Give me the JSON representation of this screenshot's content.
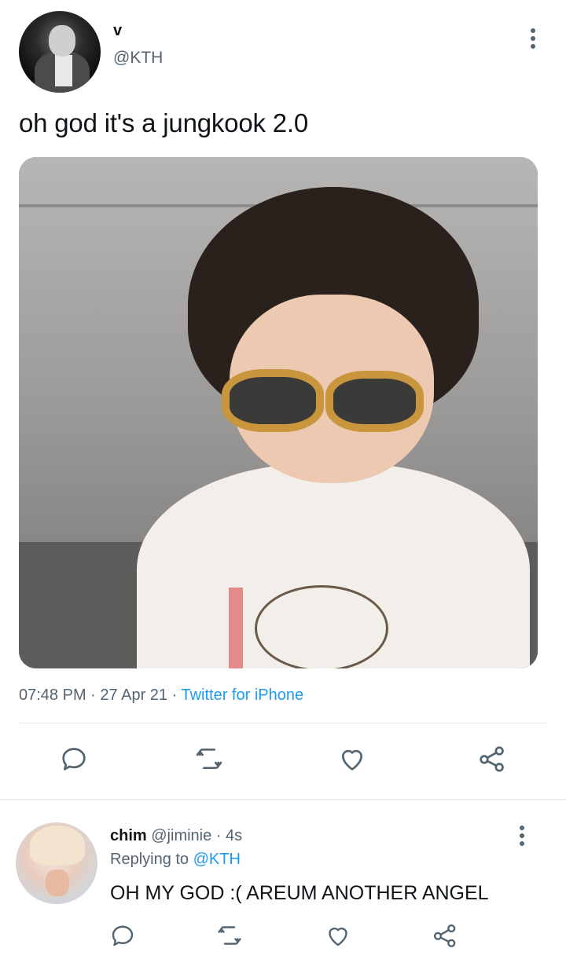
{
  "tweet": {
    "author_name": "v",
    "author_handle": "@KTH",
    "text": "oh god it's a jungkook 2.0",
    "time": "07:48 PM",
    "date": "27 Apr 21",
    "source": "Twitter for iPhone",
    "separator": "·",
    "actions": [
      {
        "name": "reply",
        "icon": "reply-icon"
      },
      {
        "name": "retweet",
        "icon": "retweet-icon"
      },
      {
        "name": "like",
        "icon": "heart-icon"
      },
      {
        "name": "share",
        "icon": "share-icon"
      }
    ]
  },
  "reply": {
    "author_name": "chim",
    "author_handle": "@jiminie",
    "age": "4s",
    "replying_label": "Replying to",
    "replying_to": "@KTH",
    "text": "OH MY GOD :( AREUM ANOTHER ANGEL"
  },
  "colors": {
    "text": "#0f1419",
    "secondary": "#536471",
    "link": "#1d9bf0",
    "divider": "#e6e6e6"
  }
}
